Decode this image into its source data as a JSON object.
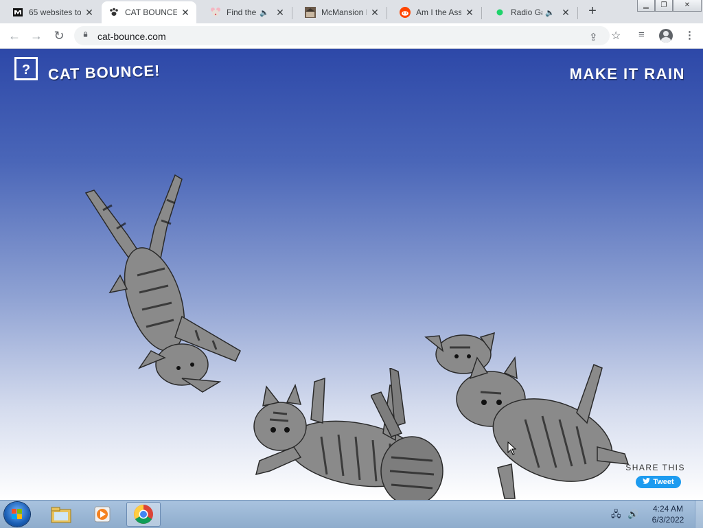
{
  "browser": {
    "tabs": [
      {
        "title": "65 websites to",
        "favicon": "medium-icon",
        "audio": false,
        "active": false
      },
      {
        "title": "CAT BOUNCE!",
        "favicon": "paw-icon",
        "audio": false,
        "active": true
      },
      {
        "title": "Find the I",
        "favicon": "mouse-face-icon",
        "audio": true,
        "active": false
      },
      {
        "title": "McMansion H",
        "favicon": "house-thumbnail-icon",
        "audio": false,
        "active": false
      },
      {
        "title": "Am I the Assh",
        "favicon": "reddit-icon",
        "audio": false,
        "active": false
      },
      {
        "title": "Radio Gar",
        "favicon": "green-dot-icon",
        "audio": true,
        "active": false
      }
    ],
    "address": "cat-bounce.com"
  },
  "page": {
    "help_label": "?",
    "site_title": "CAT BOUNCE!",
    "make_it_rain": "MAKE IT RAIN",
    "share_label": "SHARE THIS",
    "tweet_label": "Tweet"
  },
  "colors": {
    "sky_top": "#2d48a8",
    "sky_bottom": "#ffffff",
    "tweet_blue": "#1d9bf0"
  },
  "taskbar": {
    "apps": [
      "windows-explorer-icon",
      "media-player-icon",
      "chrome-icon"
    ],
    "time": "4:24 AM",
    "date": "6/3/2022"
  }
}
